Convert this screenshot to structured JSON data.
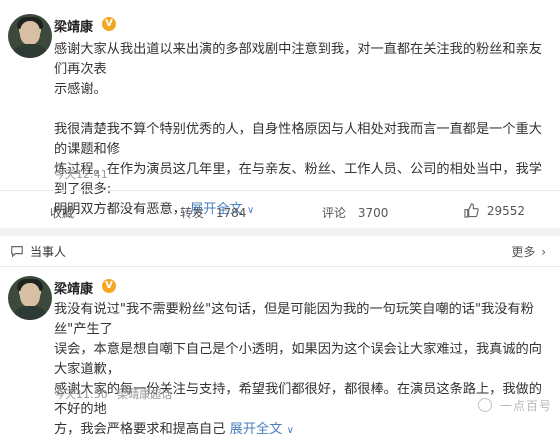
{
  "post1": {
    "username": "梁靖康",
    "verified_badge": "V",
    "paragraph1": "感谢大家从我出道以来出演的多部戏剧中注意到我，对一直都在关注我的粉丝和亲友们再次表示感谢。",
    "paragraph1_lines": [
      "感谢大家从我出道以来出演的多部戏剧中注意到我，对一直都在关注我的粉丝和亲友们再次表",
      "示感谢。"
    ],
    "paragraph2_lines": [
      "我很清楚我不算个特别优秀的人，自身性格原因与人相处对我而言一直都是一个重大的课题和修",
      "炼过程。在作为演员这几年里，在与亲友、粉丝、工作人员、公司的相处当中，我学到了很多:",
      "明明双方都没有恶意，"
    ],
    "expand_label": "展开全文",
    "expand_arrow": "∨",
    "time": "今天12:41"
  },
  "actions": {
    "collect_label": "收藏",
    "repost_label": "转发",
    "repost_count": "1784",
    "comment_label": "评论",
    "comment_count": "3700",
    "like_count": "29552"
  },
  "section_bar": {
    "label": "当事人",
    "more_label": "更多",
    "more_arrow": "›"
  },
  "post2": {
    "username": "梁靖康",
    "verified_badge": "V",
    "lines": [
      "我没有说过\"我不需要粉丝\"这句话，但是可能因为我的一句玩笑自嘲的话\"我没有粉丝\"产生了",
      "误会，本意是想自嘲下自己是个小透明，如果因为这个误会让大家难过，我真诚的向大家道歉，",
      "感谢大家的每一份关注与支持，希望我们都很好，都很棒。在演员这条路上，我做的不好的地",
      "方，我会严格要求和提高自己"
    ],
    "expand_label": "展开全文",
    "expand_arrow": "∨",
    "time": "今天11:50",
    "source": "梁靖康超话"
  },
  "watermark": "一点百号"
}
